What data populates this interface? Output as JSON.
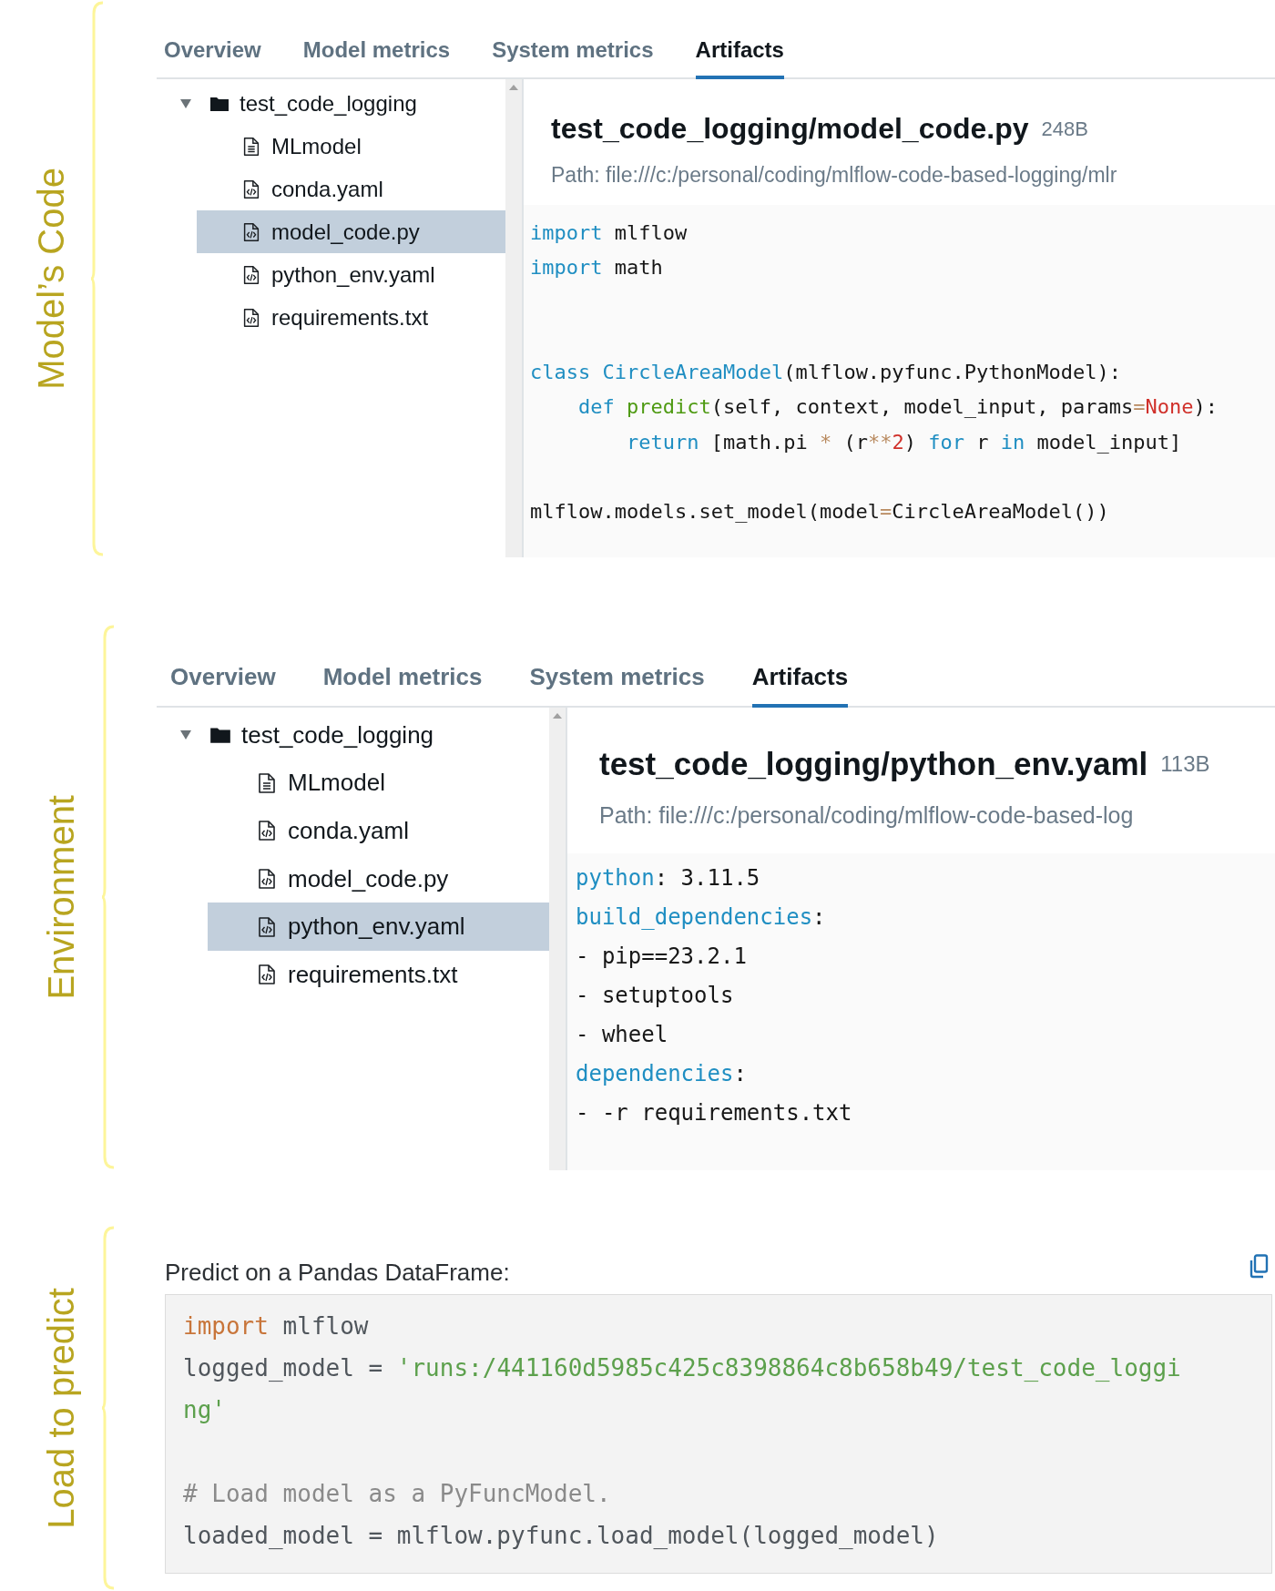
{
  "sections": [
    {
      "kind": "artifacts",
      "annotation": "Model’s Code",
      "tabs": [
        {
          "label": "Overview",
          "selected": false
        },
        {
          "label": "Model metrics",
          "selected": false
        },
        {
          "label": "System metrics",
          "selected": false
        },
        {
          "label": "Artifacts",
          "selected": true
        }
      ],
      "tree": [
        {
          "name": "test_code_logging",
          "kind": "folder",
          "expanded": true,
          "selected": false,
          "children": [
            {
              "name": "MLmodel",
              "kind": "text-file",
              "selected": false
            },
            {
              "name": "conda.yaml",
              "kind": "code-file",
              "selected": false
            },
            {
              "name": "model_code.py",
              "kind": "code-file",
              "selected": true
            },
            {
              "name": "python_env.yaml",
              "kind": "code-file",
              "selected": false
            },
            {
              "name": "requirements.txt",
              "kind": "code-file",
              "selected": false
            }
          ]
        }
      ],
      "file": {
        "title": "test_code_logging/model_code.py",
        "size": "248B",
        "path": "Path: file:///c:/personal/coding/mlflow-code-based-logging/mlr",
        "code": {
          "lines": [
            {
              "kind": "code",
              "tokens": [
                {
                  "text": "import",
                  "kind": "keyword"
                },
                {
                  "text": " mlflow",
                  "kind": "plain"
                }
              ]
            },
            {
              "kind": "code",
              "tokens": [
                {
                  "text": "import",
                  "kind": "keyword"
                },
                {
                  "text": " math",
                  "kind": "plain"
                }
              ]
            },
            {
              "kind": "blank"
            },
            {
              "kind": "blank"
            },
            {
              "kind": "code",
              "tokens": [
                {
                  "text": "class CircleAreaModel",
                  "kind": "keyword"
                },
                {
                  "text": "(mlflow.pyfunc.PythonModel):",
                  "kind": "plain"
                }
              ]
            },
            {
              "kind": "code",
              "tokens": [
                {
                  "text": "    def ",
                  "kind": "keyword"
                },
                {
                  "text": "predict",
                  "kind": "function"
                },
                {
                  "text": "(self, context, model_input, params",
                  "kind": "plain"
                },
                {
                  "text": "=",
                  "kind": "operator"
                },
                {
                  "text": "None",
                  "kind": "literal"
                },
                {
                  "text": "):",
                  "kind": "plain"
                }
              ]
            },
            {
              "kind": "code",
              "tokens": [
                {
                  "text": "        return",
                  "kind": "keyword"
                },
                {
                  "text": " [math.pi ",
                  "kind": "plain"
                },
                {
                  "text": "*",
                  "kind": "operator"
                },
                {
                  "text": " (r",
                  "kind": "plain"
                },
                {
                  "text": "**",
                  "kind": "operator"
                },
                {
                  "text": "2",
                  "kind": "literal"
                },
                {
                  "text": ") ",
                  "kind": "plain"
                },
                {
                  "text": "for",
                  "kind": "keyword"
                },
                {
                  "text": " r ",
                  "kind": "plain"
                },
                {
                  "text": "in",
                  "kind": "keyword"
                },
                {
                  "text": " model_input]",
                  "kind": "plain"
                }
              ]
            },
            {
              "kind": "blank"
            },
            {
              "kind": "code",
              "tokens": [
                {
                  "text": "mlflow.models.set_model(model",
                  "kind": "plain"
                },
                {
                  "text": "=",
                  "kind": "operator"
                },
                {
                  "text": "CircleAreaModel())",
                  "kind": "plain"
                }
              ]
            }
          ]
        }
      }
    },
    {
      "kind": "artifacts",
      "annotation": "Environment",
      "tabs": [
        {
          "label": "Overview",
          "selected": false
        },
        {
          "label": "Model metrics",
          "selected": false
        },
        {
          "label": "System metrics",
          "selected": false
        },
        {
          "label": "Artifacts",
          "selected": true
        }
      ],
      "tree": [
        {
          "name": "test_code_logging",
          "kind": "folder",
          "expanded": true,
          "selected": false,
          "children": [
            {
              "name": "MLmodel",
              "kind": "text-file",
              "selected": false
            },
            {
              "name": "conda.yaml",
              "kind": "code-file",
              "selected": false
            },
            {
              "name": "model_code.py",
              "kind": "code-file",
              "selected": false
            },
            {
              "name": "python_env.yaml",
              "kind": "code-file",
              "selected": true
            },
            {
              "name": "requirements.txt",
              "kind": "code-file",
              "selected": false
            }
          ]
        }
      ],
      "file": {
        "title": "test_code_logging/python_env.yaml",
        "size": "113B",
        "path": "Path: file:///c:/personal/coding/mlflow-code-based-log",
        "code": {
          "lines": [
            {
              "kind": "code",
              "tokens": [
                {
                  "text": "python",
                  "kind": "keyword"
                },
                {
                  "text": ": 3.11.5",
                  "kind": "plain"
                }
              ]
            },
            {
              "kind": "code",
              "tokens": [
                {
                  "text": "build_dependencies",
                  "kind": "keyword"
                },
                {
                  "text": ":",
                  "kind": "plain"
                }
              ]
            },
            {
              "kind": "code",
              "tokens": [
                {
                  "text": "- pip==23.2.1",
                  "kind": "plain"
                }
              ]
            },
            {
              "kind": "code",
              "tokens": [
                {
                  "text": "- setuptools",
                  "kind": "plain"
                }
              ]
            },
            {
              "kind": "code",
              "tokens": [
                {
                  "text": "- wheel",
                  "kind": "plain"
                }
              ]
            },
            {
              "kind": "code",
              "tokens": [
                {
                  "text": "dependencies",
                  "kind": "keyword"
                },
                {
                  "text": ":",
                  "kind": "plain"
                }
              ]
            },
            {
              "kind": "code",
              "tokens": [
                {
                  "text": "- -r requirements.txt",
                  "kind": "plain"
                }
              ]
            }
          ]
        }
      }
    },
    {
      "kind": "snippet",
      "annotation": "Load to predict",
      "label": "Predict on a Pandas DataFrame:",
      "code": {
        "lines": [
          {
            "kind": "code",
            "tokens": [
              {
                "text": "import",
                "kind": "keyword"
              },
              {
                "text": " mlflow",
                "kind": "plain"
              }
            ]
          },
          {
            "kind": "code",
            "tokens": [
              {
                "text": "logged_model = ",
                "kind": "plain"
              },
              {
                "text": "'runs:/441160d5985c425c8398864c8b658b49/test_code_loggi",
                "kind": "string"
              }
            ]
          },
          {
            "kind": "code",
            "tokens": [
              {
                "text": "ng'",
                "kind": "string"
              }
            ]
          },
          {
            "kind": "blank"
          },
          {
            "kind": "code",
            "tokens": [
              {
                "text": "# Load model as a PyFuncModel.",
                "kind": "comment"
              }
            ]
          },
          {
            "kind": "code",
            "tokens": [
              {
                "text": "loaded_model = mlflow.pyfunc.load_model(logged_model)",
                "kind": "plain"
              }
            ]
          }
        ]
      }
    }
  ]
}
